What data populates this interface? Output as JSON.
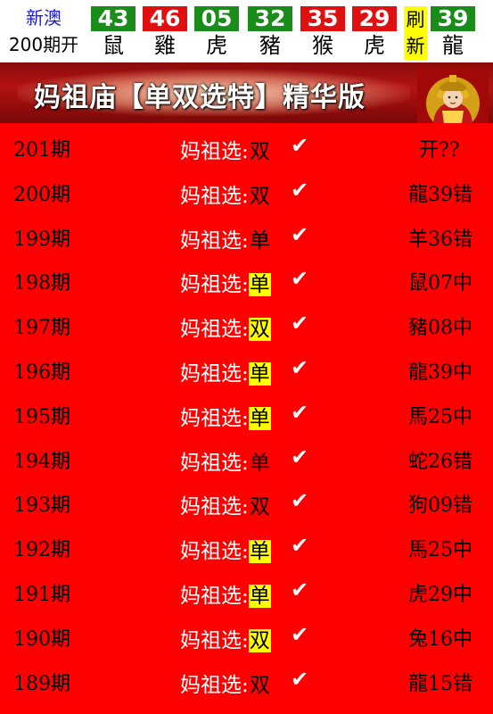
{
  "header": {
    "region": "新澳",
    "period": "200期开",
    "balls": [
      {
        "number": "43",
        "zodiac": "鼠",
        "color": "green"
      },
      {
        "number": "46",
        "zodiac": "雞",
        "color": "red"
      },
      {
        "number": "05",
        "zodiac": "虎",
        "color": "green"
      },
      {
        "number": "32",
        "zodiac": "豬",
        "color": "green"
      },
      {
        "number": "35",
        "zodiac": "猴",
        "color": "red"
      },
      {
        "number": "29",
        "zodiac": "虎",
        "color": "red"
      },
      {
        "number": "39",
        "zodiac": "龍",
        "color": "green"
      }
    ],
    "refresh_top": "刷",
    "refresh_bottom": "新"
  },
  "banner": {
    "title": "妈祖庙【单双选特】精华版"
  },
  "rows": [
    {
      "period": "201期",
      "prefix": "妈祖选:",
      "value": "双",
      "highlight": false,
      "check": "✔",
      "result": "开??"
    },
    {
      "period": "200期",
      "prefix": "妈祖选:",
      "value": "双",
      "highlight": false,
      "check": "✔",
      "result": "龍39错"
    },
    {
      "period": "199期",
      "prefix": "妈祖选:",
      "value": "单",
      "highlight": false,
      "check": "✔",
      "result": "羊36错"
    },
    {
      "period": "198期",
      "prefix": "妈祖选:",
      "value": "单",
      "highlight": true,
      "check": "✔",
      "result": "鼠07中"
    },
    {
      "period": "197期",
      "prefix": "妈祖选:",
      "value": "双",
      "highlight": true,
      "check": "✔",
      "result": "豬08中"
    },
    {
      "period": "196期",
      "prefix": "妈祖选:",
      "value": "单",
      "highlight": true,
      "check": "✔",
      "result": "龍39中"
    },
    {
      "period": "195期",
      "prefix": "妈祖选:",
      "value": "单",
      "highlight": true,
      "check": "✔",
      "result": "馬25中"
    },
    {
      "period": "194期",
      "prefix": "妈祖选:",
      "value": "单",
      "highlight": false,
      "check": "✔",
      "result": "蛇26错"
    },
    {
      "period": "193期",
      "prefix": "妈祖选:",
      "value": "双",
      "highlight": false,
      "check": "✔",
      "result": "狗09错"
    },
    {
      "period": "192期",
      "prefix": "妈祖选:",
      "value": "单",
      "highlight": true,
      "check": "✔",
      "result": "馬25中"
    },
    {
      "period": "191期",
      "prefix": "妈祖选:",
      "value": "单",
      "highlight": true,
      "check": "✔",
      "result": "虎29中"
    },
    {
      "period": "190期",
      "prefix": "妈祖选:",
      "value": "双",
      "highlight": true,
      "check": "✔",
      "result": "兔16中"
    },
    {
      "period": "189期",
      "prefix": "妈祖选:",
      "value": "双",
      "highlight": false,
      "check": "✔",
      "result": "龍15错"
    }
  ],
  "colors": {
    "background": "#ff0000",
    "ball_green": "#1a8c1a",
    "ball_red": "#e01010",
    "highlight": "#ffff00",
    "region_text": "#1a1ae6"
  },
  "icons": {
    "check": "check-icon",
    "goddess": "mazu-goddess-image"
  }
}
